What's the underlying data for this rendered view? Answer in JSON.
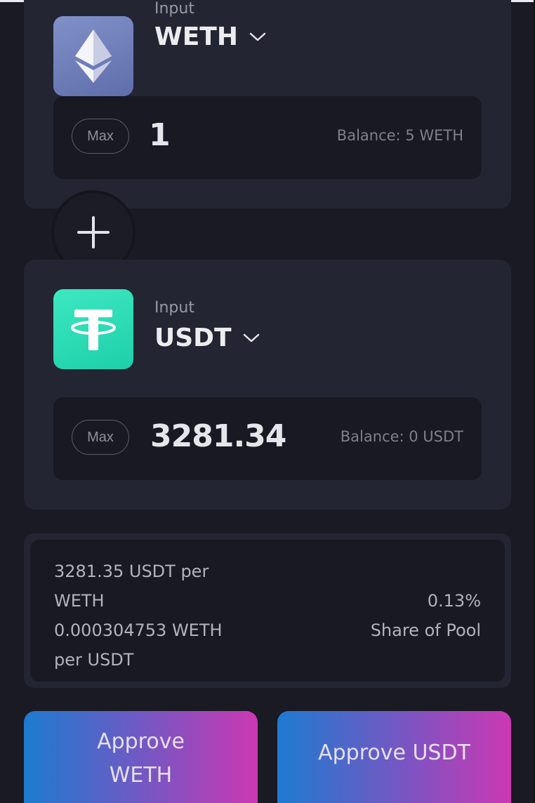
{
  "token_a": {
    "label": "Input",
    "symbol": "WETH",
    "icon": "ethereum-icon",
    "max_label": "Max",
    "amount": "1",
    "balance": "Balance: 5 WETH"
  },
  "plus_icon": "plus-icon",
  "token_b": {
    "label": "Input",
    "symbol": "USDT",
    "icon": "tether-icon",
    "max_label": "Max",
    "amount": "3281.34",
    "balance": "Balance: 0 USDT"
  },
  "pool_info": {
    "price_a_line1": "3281.35 USDT per",
    "price_a_line2": "WETH",
    "price_b_line1": "0.000304753 WETH",
    "price_b_line2": "per USDT",
    "share_value": "0.13%",
    "share_label": "Share of Pool"
  },
  "buttons": {
    "approve_a_line1": "Approve",
    "approve_a_line2": "WETH",
    "approve_b": "Approve USDT"
  },
  "colors": {
    "background": "#191a24",
    "card": "#232533",
    "input_bg": "#181922",
    "weth_icon_bg": "#7080be",
    "usdt_icon_bg": "#26dcb4",
    "gradient_start": "#1d7bd0",
    "gradient_end": "#cc38b2"
  }
}
